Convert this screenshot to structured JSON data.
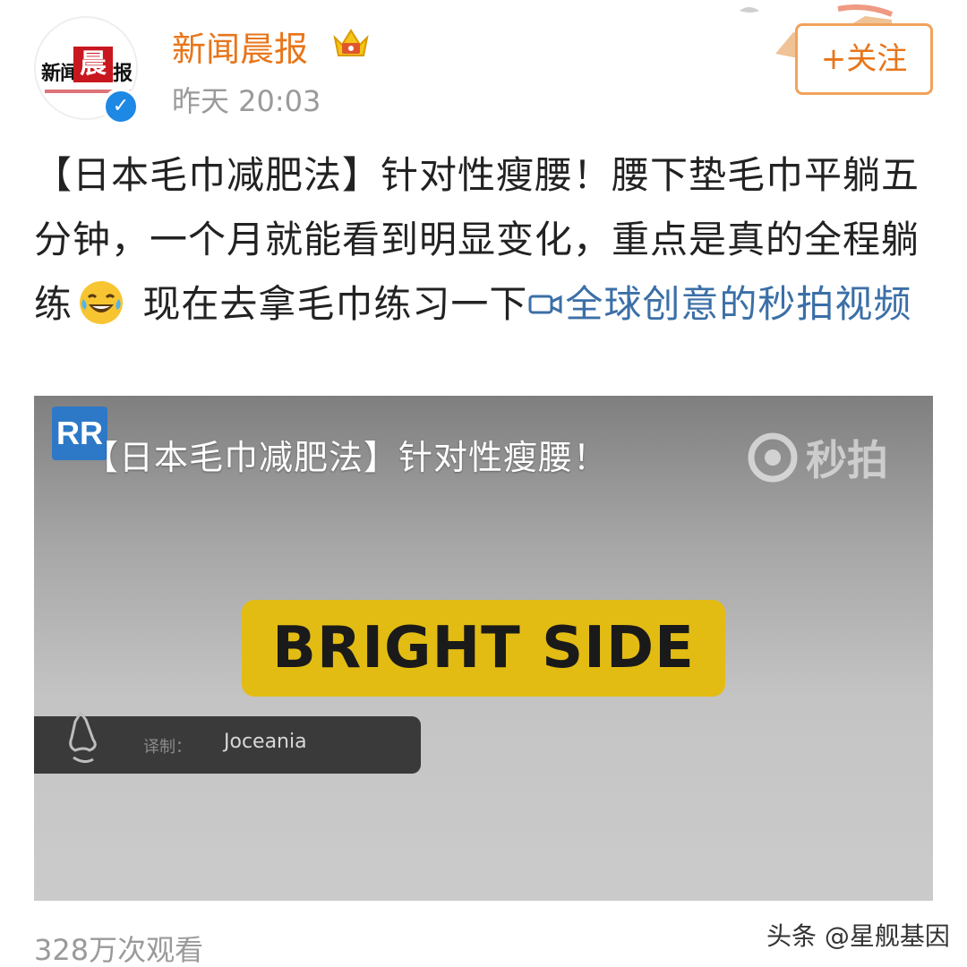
{
  "header": {
    "avatar_text_left": "新闻",
    "avatar_text_mid": "晨",
    "avatar_text_right": "报",
    "user_name": "新闻晨报",
    "post_time": "昨天 20:03",
    "follow_label": "+关注",
    "verified_icon": "verified-check-icon",
    "badge_icon": "crown-icon"
  },
  "post": {
    "text_main": "【日本毛巾减肥法】针对性瘦腰！腰下垫毛巾平躺五分钟，一个月就能看到明显变化，重点是真的全程躺练",
    "text_after_emoji": " 现在去拿毛巾练习一下",
    "emoji": "laughing-tears-emoji",
    "video_link_label": "全球创意的秒拍视频"
  },
  "video": {
    "channel_logo": "RR",
    "caption": "【日本毛巾减肥法】针对性瘦腰！",
    "platform_watermark": "秒拍",
    "badge_text": "BRIGHT SIDE",
    "translator_label": "译制：",
    "translator_name": "Joceania"
  },
  "footer": {
    "view_count": "328万次观看",
    "source_watermark": "头条 @星舰基因"
  },
  "colors": {
    "username": "#e8751a",
    "link": "#3b6fa7",
    "badge_yellow": "#e3bc13",
    "follow_border": "#f0a35c"
  }
}
